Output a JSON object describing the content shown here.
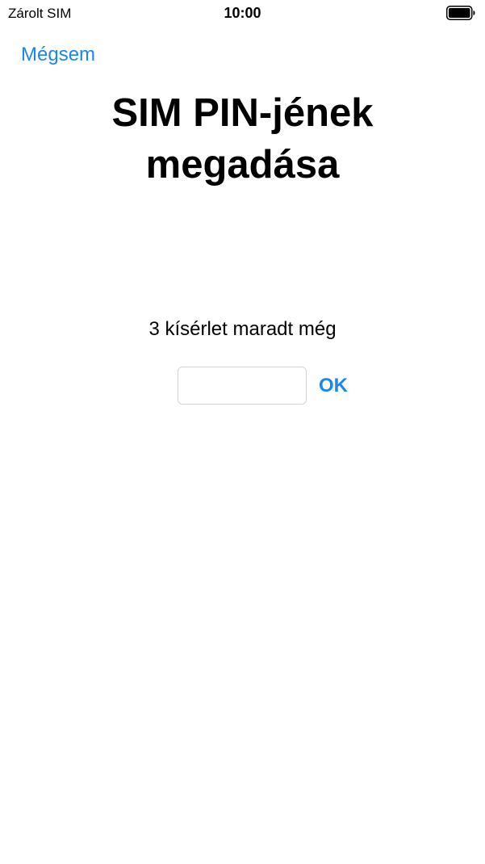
{
  "status_bar": {
    "carrier": "Zárolt SIM",
    "time": "10:00",
    "battery_icon": "battery-full-icon"
  },
  "nav": {
    "cancel_label": "Mégsem"
  },
  "title": {
    "line1": "SIM PIN-jének",
    "line2": "megadása"
  },
  "pin_entry": {
    "attempts_text": "3 kísérlet maradt még",
    "value": "",
    "ok_label": "OK"
  },
  "colors": {
    "accent": "#1a86f0",
    "background": "#ffffff",
    "text": "#000000",
    "input_border": "#d2d2d7"
  }
}
